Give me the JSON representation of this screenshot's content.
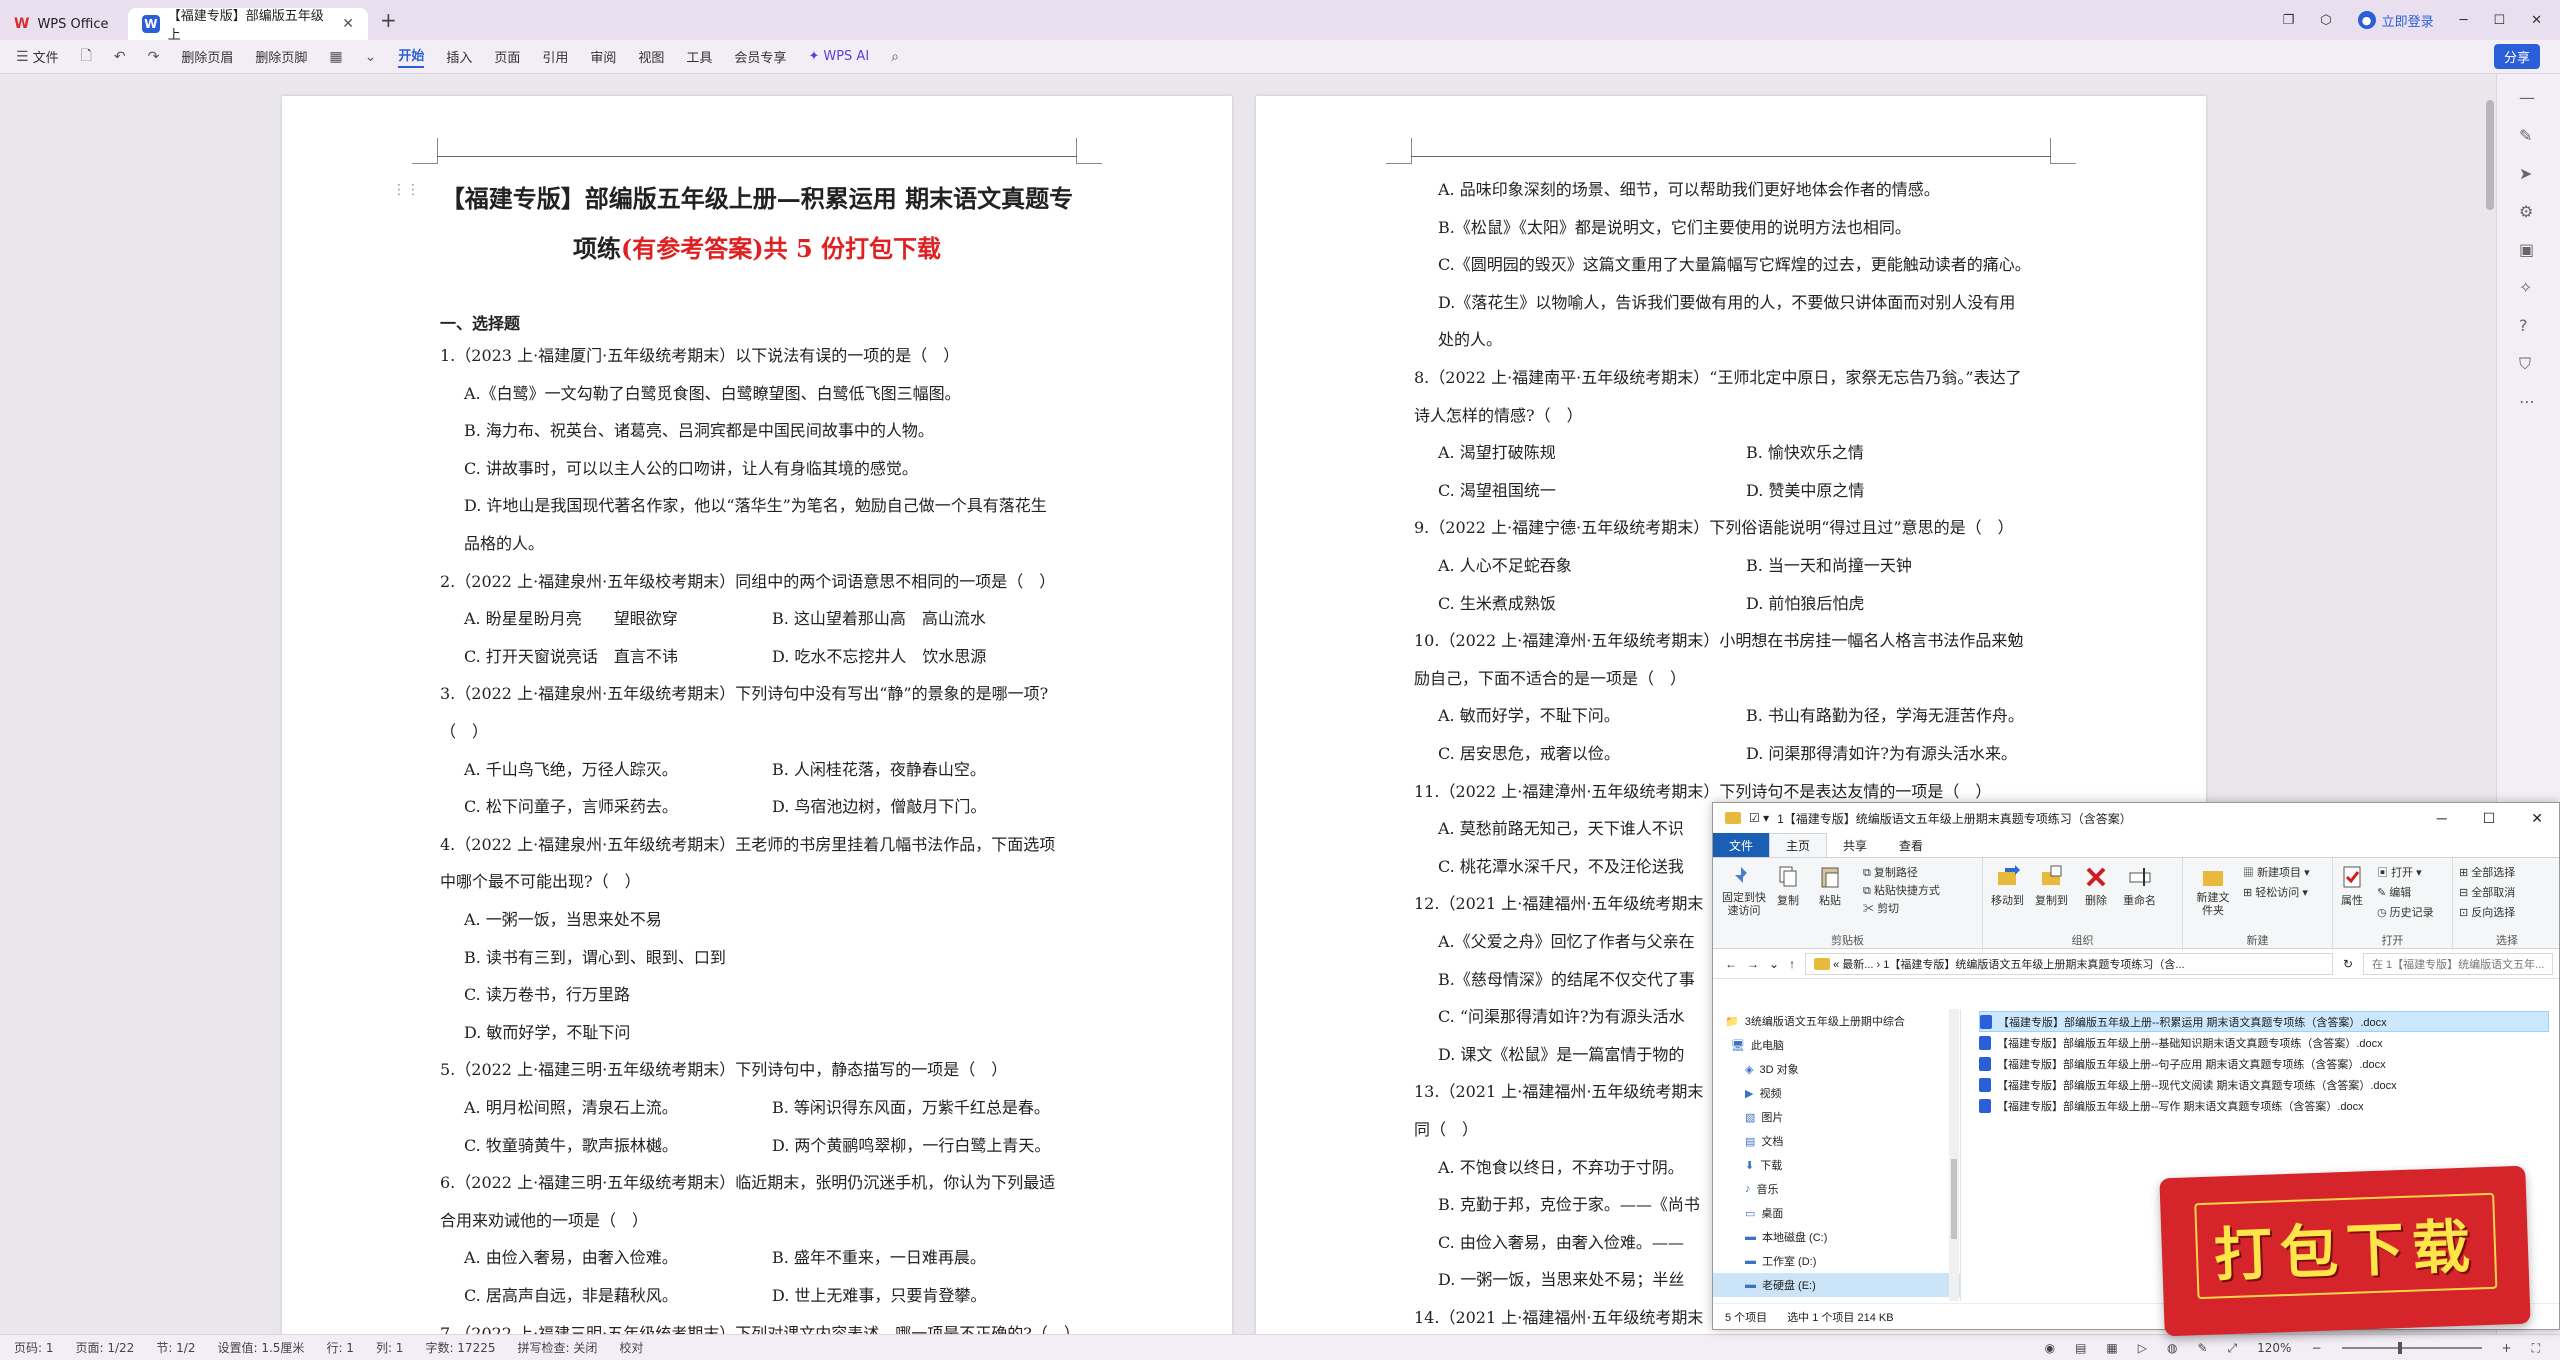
{
  "titlebar": {
    "app_tab": "WPS Office",
    "doc_tab": "【福建专版】部编版五年级上",
    "login": "立即登录"
  },
  "ribbon": {
    "file": "文件",
    "del_page": "删除页眉",
    "del_footer": "删除页脚",
    "tabs": [
      "开始",
      "插入",
      "页面",
      "引用",
      "审阅",
      "视图",
      "工具",
      "会员专享"
    ],
    "ai": "WPS AI",
    "share": "分享"
  },
  "page1": {
    "title_a": "【福建专版】部编版五年级上册—积累运用 期末语文真题专",
    "title_b": "项练",
    "title_red": "(有参考答案)共 5 份打包下载",
    "section": "一、选择题",
    "lines": [
      {
        "t": "1.（2023 上·福建厦门·五年级统考期末）以下说法有误的一项的是（　）",
        "ind": false
      },
      {
        "t": "A.《白鹭》一文勾勒了白鹭觅食图、白鹭瞭望图、白鹭低飞图三幅图。",
        "ind": true
      },
      {
        "t": "B. 海力布、祝英台、诸葛亮、吕洞宾都是中国民间故事中的人物。",
        "ind": true
      },
      {
        "t": "C. 讲故事时，可以以主人公的口吻讲，让人有身临其境的感觉。",
        "ind": true
      },
      {
        "t": "D. 许地山是我国现代著名作家，他以“落华生”为笔名，勉励自己做一个具有落花生",
        "ind": true
      },
      {
        "t": "品格的人。",
        "ind": true
      },
      {
        "t": "2.（2022 上·福建泉州·五年级校考期末）同组中的两个词语意思不相同的一项是（　）",
        "ind": false
      },
      {
        "t": "A. 盼星星盼月亮　　望眼欲穿",
        "ind": true,
        "b": "B. 这山望着那山高　高山流水"
      },
      {
        "t": "C. 打开天窗说亮话　直言不讳",
        "ind": true,
        "b": "D. 吃水不忘挖井人　饮水思源"
      },
      {
        "t": "3.（2022 上·福建泉州·五年级统考期末）下列诗句中没有写出“静”的景象的是哪一项?",
        "ind": false
      },
      {
        "t": "（　）",
        "ind": false
      },
      {
        "t": "A. 千山鸟飞绝，万径人踪灭。",
        "ind": true,
        "b": "B. 人闲桂花落，夜静春山空。"
      },
      {
        "t": "C. 松下问童子，言师采药去。",
        "ind": true,
        "b": "D. 鸟宿池边树，僧敲月下门。"
      },
      {
        "t": "4.（2022 上·福建泉州·五年级统考期末）王老师的书房里挂着几幅书法作品，下面选项",
        "ind": false
      },
      {
        "t": "中哪个最不可能出现?（　）",
        "ind": false
      },
      {
        "t": "A. 一粥一饭，当思来处不易",
        "ind": true
      },
      {
        "t": "B. 读书有三到，谓心到、眼到、口到",
        "ind": true
      },
      {
        "t": "C. 读万卷书，行万里路",
        "ind": true
      },
      {
        "t": "D. 敏而好学，不耻下问",
        "ind": true
      },
      {
        "t": "5.（2022 上·福建三明·五年级统考期末）下列诗句中，静态描写的一项是（　）",
        "ind": false
      },
      {
        "t": "A. 明月松间照，清泉石上流。",
        "ind": true,
        "b": "B. 等闲识得东风面，万紫千红总是春。"
      },
      {
        "t": "C. 牧童骑黄牛，歌声振林樾。",
        "ind": true,
        "b": "D. 两个黄鹂鸣翠柳，一行白鹭上青天。"
      },
      {
        "t": "6.（2022 上·福建三明·五年级统考期末）临近期末，张明仍沉迷手机，你认为下列最适",
        "ind": false
      },
      {
        "t": "合用来劝诫他的一项是（　）",
        "ind": false
      },
      {
        "t": "A. 由俭入奢易，由奢入俭难。",
        "ind": true,
        "b": "B. 盛年不重来，一日难再晨。"
      },
      {
        "t": "C. 居高声自远，非是藉秋风。",
        "ind": true,
        "b": "D. 世上无难事，只要肯登攀。"
      },
      {
        "t": "7.（2022 上·福建三明·五年级统考期末）下列对课文内容表述，哪一项是不正确的?（　）",
        "ind": false
      }
    ]
  },
  "page2": {
    "lines": [
      {
        "t": "A. 品味印象深刻的场景、细节，可以帮助我们更好地体会作者的情感。",
        "ind": true
      },
      {
        "t": "B.《松鼠》《太阳》都是说明文，它们主要使用的说明方法也相同。",
        "ind": true
      },
      {
        "t": "C.《圆明园的毁灭》这篇文重用了大量篇幅写它辉煌的过去，更能触动读者的痛心。",
        "ind": true
      },
      {
        "t": "D.《落花生》以物喻人，告诉我们要做有用的人，不要做只讲体面而对别人没有用",
        "ind": true
      },
      {
        "t": "处的人。",
        "ind": true
      },
      {
        "t": "8.（2022 上·福建南平·五年级统考期末）“王师北定中原日，家祭无忘告乃翁。”表达了",
        "ind": false
      },
      {
        "t": "诗人怎样的情感?（　）",
        "ind": false
      },
      {
        "t": "A. 渴望打破陈规",
        "ind": true,
        "b": "B. 愉快欢乐之情"
      },
      {
        "t": "C. 渴望祖国统一",
        "ind": true,
        "b": "D. 赞美中原之情"
      },
      {
        "t": "9.（2022 上·福建宁德·五年级统考期末）下列俗语能说明“得过且过”意思的是（　）",
        "ind": false
      },
      {
        "t": "A. 人心不足蛇吞象",
        "ind": true,
        "b": "B. 当一天和尚撞一天钟"
      },
      {
        "t": "C. 生米煮成熟饭",
        "ind": true,
        "b": "D. 前怕狼后怕虎"
      },
      {
        "t": "10.（2022 上·福建漳州·五年级统考期末）小明想在书房挂一幅名人格言书法作品来勉",
        "ind": false
      },
      {
        "t": "励自己，下面不适合的是一项是（　）",
        "ind": false
      },
      {
        "t": "A. 敏而好学，不耻下问。",
        "ind": true,
        "b": "B. 书山有路勤为径，学海无涯苦作舟。"
      },
      {
        "t": "C. 居安思危，戒奢以俭。",
        "ind": true,
        "b": "D. 问渠那得清如许?为有源头活水来。"
      },
      {
        "t": "11.（2022 上·福建漳州·五年级统考期末）下列诗句不是表达友情的一项是（　）",
        "ind": false
      },
      {
        "t": "A. 莫愁前路无知己，天下谁人不识",
        "ind": true
      },
      {
        "t": "C. 桃花潭水深千尺，不及汪伦送我",
        "ind": true
      },
      {
        "t": "12.（2021 上·福建福州·五年级统考期末",
        "ind": false
      },
      {
        "t": "A.《父爱之舟》回忆了作者与父亲在",
        "ind": true
      },
      {
        "t": "B.《慈母情深》的结尾不仅交代了事",
        "ind": true
      },
      {
        "t": "C. “问渠那得清如许?为有源头活水",
        "ind": true
      },
      {
        "t": "D. 课文《松鼠》是一篇富情于物的",
        "ind": true
      },
      {
        "t": "13.（2021 上·福建福州·五年级统考期末",
        "ind": false
      },
      {
        "t": "同（　）",
        "ind": false
      },
      {
        "t": "A. 不饱食以终日，不弃功于寸阴。",
        "ind": true
      },
      {
        "t": "B. 克勤于邦，克俭于家。——《尚书",
        "ind": true
      },
      {
        "t": "C. 由俭入奢易，由奢入俭难。——",
        "ind": true
      },
      {
        "t": "D. 一粥一饭，当思来处不易；半丝",
        "ind": true
      },
      {
        "t": "14.（2021 上·福建福州·五年级统考期末",
        "ind": false
      }
    ]
  },
  "status": {
    "page": "页码: 1",
    "pages": "页面: 1/22",
    "section": "节: 1/2",
    "setting": "设置值: 1.5厘米",
    "row": "行: 1",
    "col": "列: 1",
    "words": "字数: 17225",
    "spell": "拼写检查: 关闭",
    "proof": "校对",
    "zoom": "120%"
  },
  "explorer": {
    "title": "1【福建专版】统编版语文五年级上册期末真题专项练习（含答案）",
    "tabs": [
      "文件",
      "主页",
      "共享",
      "查看"
    ],
    "groups": [
      "剪贴板",
      "组织",
      "新建",
      "打开",
      "选择"
    ],
    "buttons": {
      "pin": "固定到快速访问",
      "copy": "复制",
      "paste": "粘贴",
      "copy_path": "复制路径",
      "paste_shortcut": "粘贴快捷方式",
      "cut": "剪切",
      "move_to": "移动到",
      "copy_to": "复制到",
      "delete": "删除",
      "rename": "重命名",
      "new_folder": "新建文件夹",
      "new_item": "新建项目",
      "easy_access": "轻松访问",
      "properties": "属性",
      "open": "打开",
      "edit": "编辑",
      "history": "历史记录",
      "select_all": "全部选择",
      "select_none": "全部取消",
      "invert": "反向选择"
    },
    "address": "«  最新...  ›  1【福建专版】统编版语文五年级上册期末真题专项练习（含...",
    "search": "在 1【福建专版】统编版语文五年...",
    "nav": [
      {
        "label": "3统编版语文五年级上册期中综合",
        "icon": "folder"
      },
      {
        "label": "此电脑",
        "icon": "pc"
      },
      {
        "label": "3D 对象",
        "icon": "cube"
      },
      {
        "label": "视频",
        "icon": "video"
      },
      {
        "label": "图片",
        "icon": "picture"
      },
      {
        "label": "文档",
        "icon": "doc"
      },
      {
        "label": "下载",
        "icon": "download"
      },
      {
        "label": "音乐",
        "icon": "music"
      },
      {
        "label": "桌面",
        "icon": "desktop"
      },
      {
        "label": "本地磁盘 (C:)",
        "icon": "drive"
      },
      {
        "label": "工作室 (D:)",
        "icon": "drive"
      },
      {
        "label": "老硬盘 (E:)",
        "icon": "drive"
      }
    ],
    "files": [
      "【福建专版】部编版五年级上册--积累运用 期末语文真题专项练（含答案）.docx",
      "【福建专版】部编版五年级上册--基础知识期末语文真题专项练（含答案）.docx",
      "【福建专版】部编版五年级上册--句子应用 期末语文真题专项练（含答案）.docx",
      "【福建专版】部编版五年级上册--现代文阅读 期末语文真题专项练（含答案）.docx",
      "【福建专版】部编版五年级上册--写作 期末语文真题专项练（含答案）.docx"
    ],
    "status_items": "5 个项目",
    "status_selected": "选中 1 个项目  214 KB"
  },
  "banner": {
    "text": "打包下载"
  },
  "colors": {
    "accent": "#2b5fd9",
    "red_text": "#e02020",
    "banner": "#d6252a",
    "banner_text": "#ffe44a"
  }
}
